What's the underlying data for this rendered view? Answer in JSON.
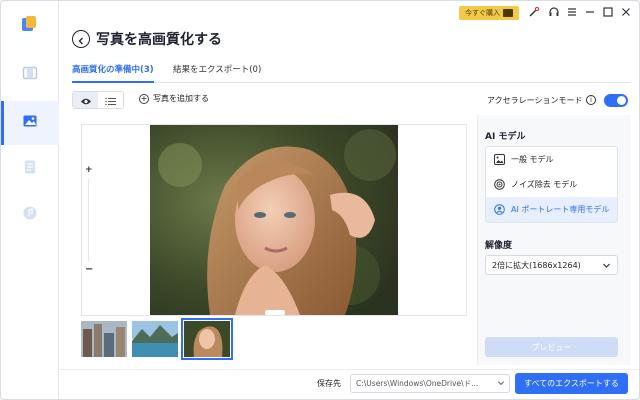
{
  "titlebar": {
    "buy_label": "今すぐ購入",
    "icons": [
      "cart-icon",
      "wand-icon",
      "headset-icon",
      "menu-icon",
      "minimize-icon",
      "maximize-icon",
      "close-icon"
    ]
  },
  "rail": {
    "items": [
      {
        "icon": "video-icon",
        "active": false
      },
      {
        "icon": "photo-icon",
        "active": true
      },
      {
        "icon": "document-icon",
        "active": false
      },
      {
        "icon": "music-icon",
        "active": false
      }
    ]
  },
  "header": {
    "title": "写真を高画質化する"
  },
  "tabs": [
    {
      "label": "高画質化の準備中(3)",
      "active": true
    },
    {
      "label": "結果をエクスポート(0)",
      "active": false
    }
  ],
  "toolbar": {
    "add_photo_label": "写真を追加する",
    "accel_label": "アクセラレーションモード",
    "accel_on": true
  },
  "preview": {
    "zoom_plus": "+",
    "zoom_minus": "−"
  },
  "thumbnails": [
    {
      "name": "city-photo",
      "selected": false
    },
    {
      "name": "lake-photo",
      "selected": false
    },
    {
      "name": "portrait-photo",
      "selected": true
    }
  ],
  "ai_model": {
    "heading": "AI モデル",
    "options": [
      {
        "label": "一般 モデル",
        "icon": "image-icon",
        "selected": false
      },
      {
        "label": "ノイズ除去 モデル",
        "icon": "denoise-icon",
        "selected": false
      },
      {
        "label": "AI ポートレート専用モデル",
        "icon": "portrait-icon",
        "selected": true
      }
    ]
  },
  "resolution": {
    "heading": "解像度",
    "selected": "2倍に拡大(1686x1264)"
  },
  "preview_button": "プレビュー",
  "footer": {
    "save_label": "保存先",
    "path": "C:\\Users\\Windows\\OneDrive\\ド...",
    "export_button": "すべてのエクスポートする"
  },
  "colors": {
    "accent": "#2f6ff5",
    "buy": "#f3c94a"
  }
}
